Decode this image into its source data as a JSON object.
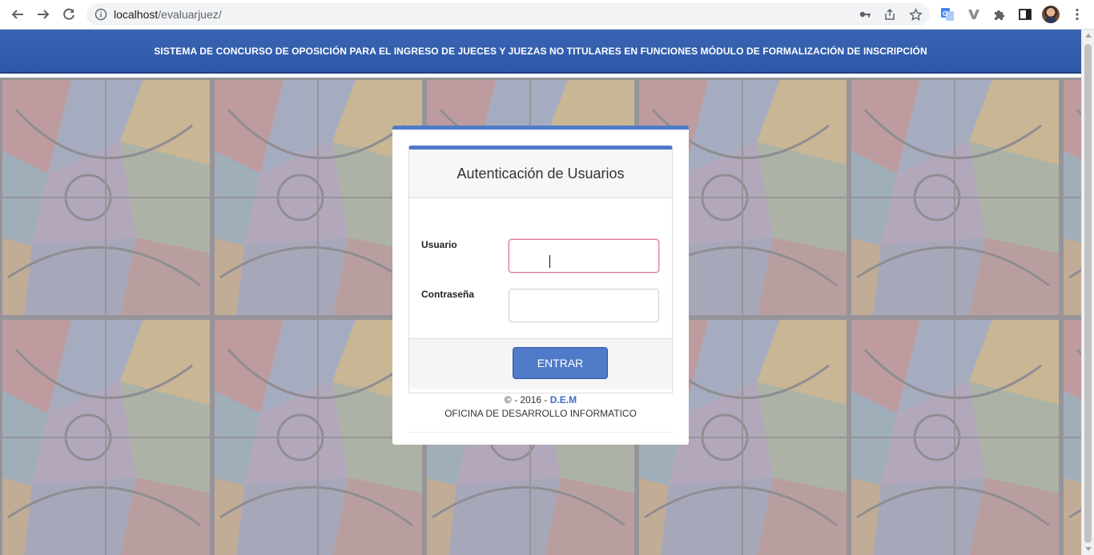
{
  "browser": {
    "url_host": "localhost",
    "url_path": "/evaluarjuez/"
  },
  "header": {
    "title": "SISTEMA DE CONCURSO DE OPOSICIÓN PARA EL INGRESO DE JUECES Y JUEZAS NO TITULARES EN FUNCIONES MÓDULO DE FORMALIZACIÓN DE INSCRIPCIÓN"
  },
  "login": {
    "title": "Autenticación de Usuarios",
    "user_label": "Usuario",
    "user_value": "",
    "password_label": "Contraseña",
    "password_value": "",
    "submit_label": "ENTRAR"
  },
  "footer": {
    "copyright": "© - 2016 - ",
    "brand": "D.E.M",
    "office": "OFICINA DE DESARROLLO INFORMATICO"
  },
  "colors": {
    "header": "#3a64b4",
    "accent": "#4f7ac7",
    "focus_border": "#e07a92"
  }
}
